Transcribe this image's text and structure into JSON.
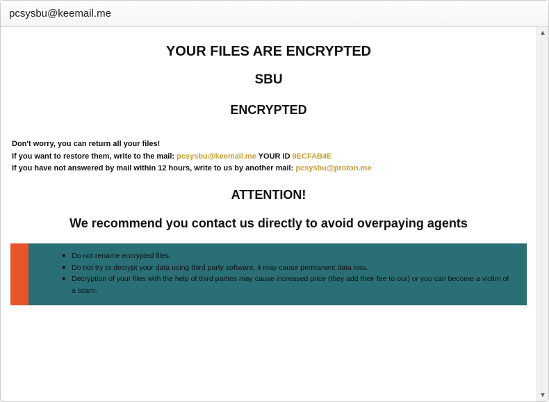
{
  "titlebar": {
    "title": "pcsysbu@keemail.me"
  },
  "heading1": "YOUR FILES ARE ENCRYPTED",
  "heading2": "SBU",
  "heading3": "ENCRYPTED",
  "body": {
    "line1": "Don't worry, you can return all your files!",
    "line2_prefix": "If you want to restore them, write to the mail:   ",
    "email1": "pcsysbu@keemail.me",
    "id_label": "   YOUR ID ",
    "id_value": "9ECFAB4E",
    "line3_prefix": "If you have not answered by mail within 12 hours, write to us by another mail:   ",
    "email2": "pcsysbu@proton.me"
  },
  "attention": "ATTENTION!",
  "recommend": "We recommend you contact us directly to avoid overpaying agents",
  "warnings": {
    "w1": "Do not rename encrypted files.",
    "w2": "Do not try to decrypt your data using third party software, it may cause permanent data loss.",
    "w3": "Decryption of your files with the help of third parties may cause increased price (they add their fee to our) or you can become a victim of a scam."
  },
  "icons": {
    "arrow_up": "▲",
    "arrow_down": "▼"
  }
}
